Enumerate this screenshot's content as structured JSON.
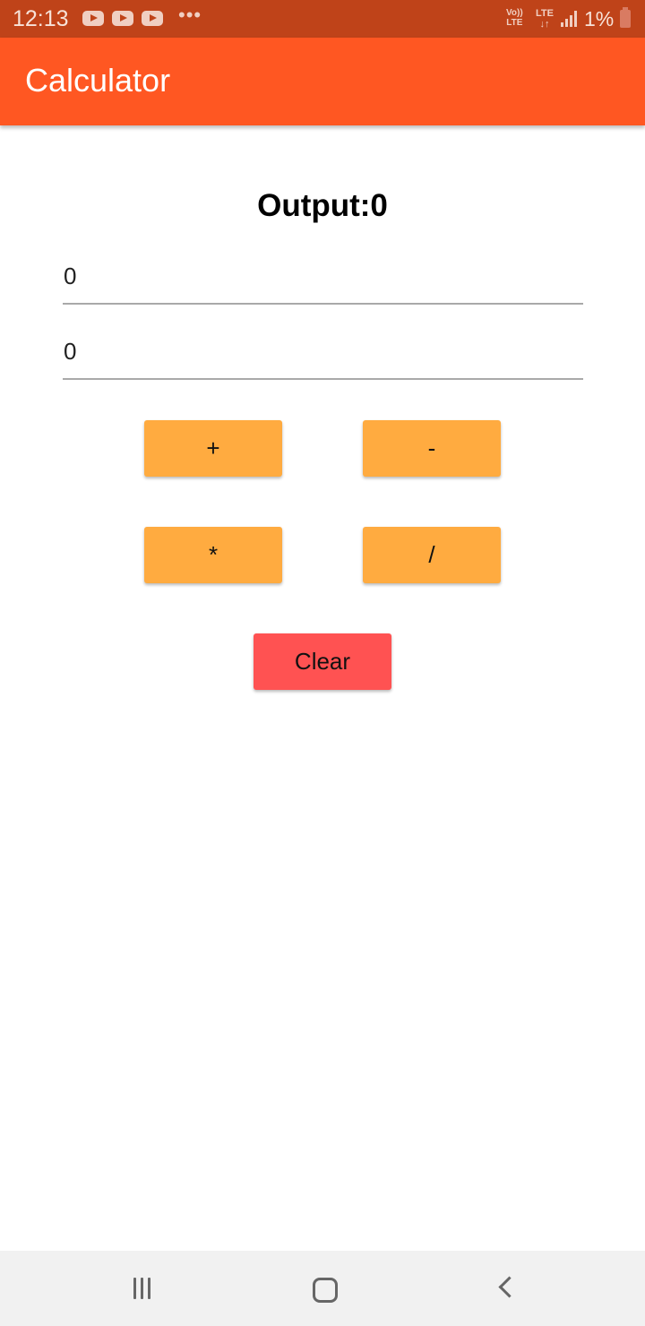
{
  "status_bar": {
    "time": "12:13",
    "notification_icons": [
      "youtube-icon",
      "youtube-icon",
      "youtube-icon"
    ],
    "overflow": "•••",
    "volte_top": "Vo))",
    "volte_bottom": "LTE",
    "lte_top": "LTE",
    "lte_bottom": "↓↑",
    "battery": "1%"
  },
  "app_bar": {
    "title": "Calculator",
    "color": "#ff5722"
  },
  "main": {
    "output_label": "Output:0",
    "input1": {
      "value": "0"
    },
    "input2": {
      "value": "0"
    },
    "buttons": {
      "add": "+",
      "subtract": "-",
      "multiply": "*",
      "divide": "/",
      "clear": "Clear"
    },
    "colors": {
      "operator_button": "#ffab40",
      "clear_button": "#ff5252"
    }
  },
  "nav_bar": {
    "icons": [
      "recents-icon",
      "home-icon",
      "back-icon"
    ]
  }
}
